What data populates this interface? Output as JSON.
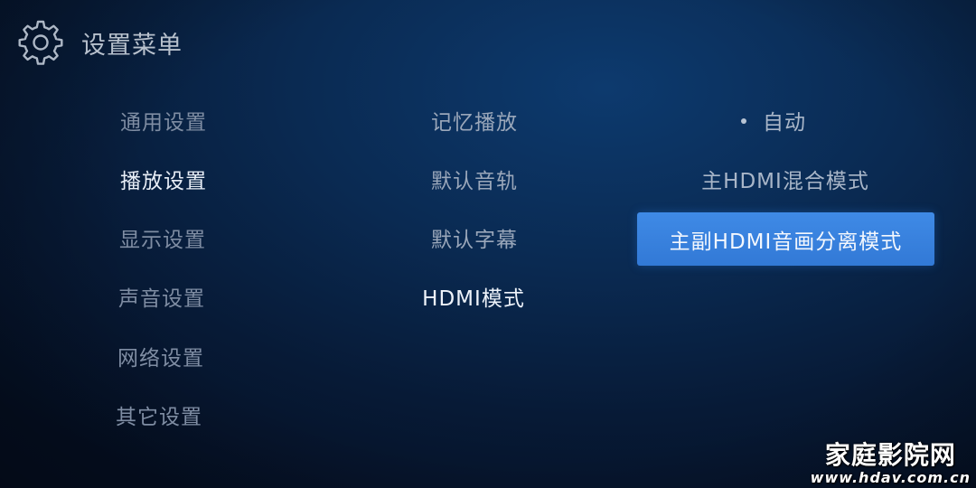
{
  "header": {
    "title": "设置菜单",
    "icon": "gear-icon"
  },
  "categories": [
    {
      "label": "通用设置",
      "active": false
    },
    {
      "label": "播放设置",
      "active": true
    },
    {
      "label": "显示设置",
      "active": false
    },
    {
      "label": "声音设置",
      "active": false
    },
    {
      "label": "网络设置",
      "active": false
    },
    {
      "label": "其它设置",
      "active": false
    }
  ],
  "playback_options": [
    {
      "label": "记忆播放",
      "active": false
    },
    {
      "label": "默认音轨",
      "active": false
    },
    {
      "label": "默认字幕",
      "active": false
    },
    {
      "label": "HDMI模式",
      "active": true
    }
  ],
  "hdmi_modes": [
    {
      "label": "自动",
      "selected": true,
      "focused": false
    },
    {
      "label": "主HDMI混合模式",
      "selected": false,
      "focused": false
    },
    {
      "label": "主副HDMI音画分离模式",
      "selected": false,
      "focused": true
    }
  ],
  "watermark": {
    "name": "家庭影院网",
    "url": "www.hdav.com.cn"
  },
  "colors": {
    "accent": "#3a84e0",
    "background": "#0a2a52"
  }
}
